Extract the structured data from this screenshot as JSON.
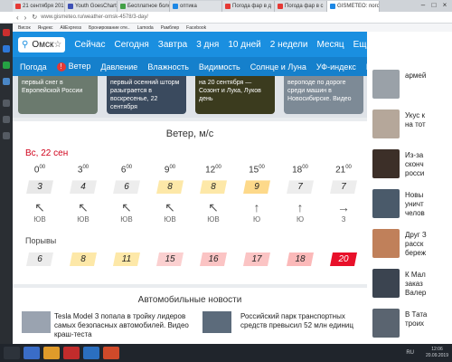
{
  "browser": {
    "tabs": [
      {
        "label": "21 сентября 2019 в с",
        "color": "#e53935"
      },
      {
        "label": "Youth GoesChart",
        "color": "#3f51b5"
      },
      {
        "label": "Бесплатное боло",
        "color": "#43a047"
      },
      {
        "label": "оптика",
        "color": "#1e88e5"
      },
      {
        "label": "Погода фар в д",
        "color": "#e53935"
      },
      {
        "label": "Погода фар в с",
        "color": "#e53935"
      },
      {
        "label": "GISMETEO: погода в",
        "color": "#1e88e5"
      }
    ],
    "address": "www.gismeteo.ru/weather-omsk-4578/3-day/",
    "bookmarks": [
      "Висок",
      "Яндекс",
      "AliExpress",
      "Бронирование оте..",
      "Lamoda",
      "Рамблер",
      "Facebook"
    ]
  },
  "nav": {
    "city": "Омск",
    "items": [
      "Сейчас",
      "Сегодня",
      "Завтра",
      "3 дня",
      "10 дней",
      "2 недели",
      "Месяц",
      "Ещё"
    ]
  },
  "subnav": {
    "items": [
      "Погода",
      "Ветер",
      "Давление",
      "Влажность",
      "Видимость",
      "Солнце и Луна",
      "УФ-индекс",
      "Г/м активность"
    ]
  },
  "news": [
    {
      "text": "первый снег в Европейской России",
      "color": "#6b7a6e"
    },
    {
      "text": "первый осенний шторм разыграется в воскресенье, 22 сентября",
      "color": "#3a4a5e"
    },
    {
      "text": "на 20 сентября — Созонт и Лука, Луков день",
      "color": "#3b3b1e"
    },
    {
      "text": "вероподе по дороге среди машин в Новосибирске. Видео",
      "color": "#7d8a96"
    }
  ],
  "wind": {
    "title": "Ветер, м/с",
    "date": "Вс, 22 сен",
    "hours": [
      "0",
      "3",
      "6",
      "9",
      "12",
      "15",
      "18",
      "21"
    ],
    "minutes": "00",
    "speeds": [
      "3",
      "4",
      "6",
      "8",
      "8",
      "9",
      "7",
      "7"
    ],
    "speed_colors": [
      "#e8e8e8",
      "#ececec",
      "#ededed",
      "#fde8a8",
      "#fde8a8",
      "#fdd98a",
      "#ededed",
      "#ededed"
    ],
    "arrows": [
      "↖",
      "↖",
      "↖",
      "↖",
      "↖",
      "↑",
      "↑",
      "→"
    ],
    "directions": [
      "ЮВ",
      "ЮВ",
      "ЮВ",
      "ЮВ",
      "ЮВ",
      "Ю",
      "Ю",
      "З"
    ],
    "gusts_title": "Порывы",
    "gusts": [
      "6",
      "8",
      "11",
      "15",
      "16",
      "17",
      "18",
      "20"
    ],
    "gust_colors": [
      "#ececec",
      "#fde8a8",
      "#fde8a8",
      "#fbd0d0",
      "#fbc4c4",
      "#fbc4c4",
      "#fbb9b9",
      "#e8102a"
    ]
  },
  "auto": {
    "title": "Автомобильные новости",
    "items": [
      {
        "text": "Tesla Model 3 попала в тройку лидеров самых безопасных автомобилей. Видео краш-теста"
      },
      {
        "text": "Российский парк транспортных средств превысил 52 млн единиц"
      }
    ]
  },
  "sidebar": {
    "items": [
      {
        "text": "армей",
        "color": "#9aa1a8"
      },
      {
        "text": "Укус к\nна тот",
        "color": "#b5a79a"
      },
      {
        "text": "Из-за\nсконч\nросси",
        "color": "#3c2f28"
      },
      {
        "text": "Новы\nуничт\nчелов",
        "color": "#4a5a6a"
      },
      {
        "text": "Друг З\nрасск\nбереж",
        "color": "#c0805a"
      },
      {
        "text": "К Мал\nзаказ\nВалер",
        "color": "#3b4450"
      },
      {
        "text": "В Тата\nтроих",
        "color": "#5a6470"
      }
    ]
  },
  "system": {
    "lang": "RU",
    "time": "12:06",
    "date": "20.09.2019"
  }
}
